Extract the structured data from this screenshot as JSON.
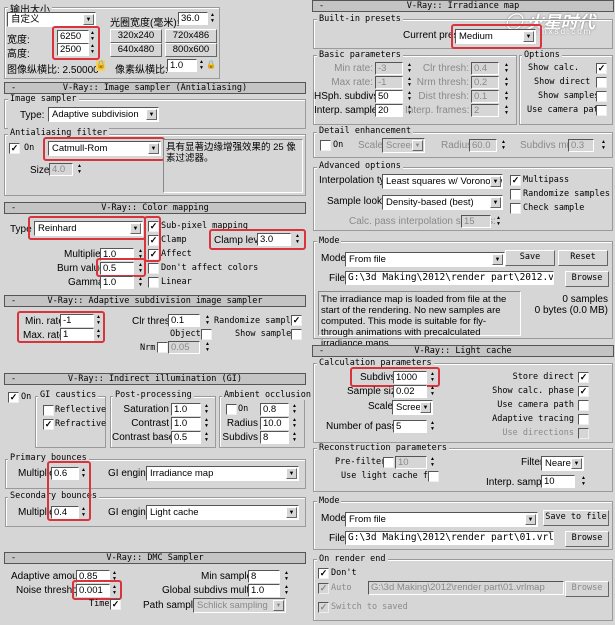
{
  "watermark": {
    "logo": "火星时代",
    "url": "www.hxsd.com"
  },
  "output_size": {
    "title": "输出大小",
    "preset": "自定义",
    "aperture_label": "光圈宽度(毫米):",
    "aperture": "36.0",
    "width_label": "宽度:",
    "width": "6250",
    "height_label": "高度:",
    "height": "2500",
    "presets": [
      "320x240",
      "720x486",
      "640x480",
      "800x600"
    ],
    "image_aspect": "图像纵横比: 2.50000",
    "pixel_aspect_label": "像素纵横比:",
    "pixel_aspect": "1.0"
  },
  "image_sampler": {
    "title": "V-Ray:: Image sampler (Antialiasing)",
    "group": "Image sampler",
    "type_label": "Type:",
    "type": "Adaptive subdivision",
    "aa_group": "Antialiasing filter",
    "on_label": "On",
    "filter": "Catmull-Rom",
    "filter_desc": "具有显著边缘增强效果的 25 像素过滤器。",
    "size_label": "Size:",
    "size": "4.0"
  },
  "color_mapping": {
    "title": "V-Ray:: Color mapping",
    "type_label": "Type",
    "type": "Reinhard",
    "sub_pixel": "Sub-pixel mapping",
    "clamp": "Clamp",
    "affect": "Affect",
    "clamp_level_label": "Clamp level:",
    "clamp_level": "3.0",
    "multiplier_label": "Multiplier:",
    "multiplier": "1.0",
    "burn_label": "Burn value:",
    "burn": "0.5",
    "dont_affect": "Don't affect colors",
    "gamma_label": "Gamma:",
    "gamma": "1.0",
    "linear": "Linear"
  },
  "adaptive": {
    "title": "V-Ray:: Adaptive subdivision image sampler",
    "min_label": "Min. rate:",
    "min": "-1",
    "max_label": "Max. rate:",
    "max": "1",
    "clr_label": "Clr thresh:",
    "clr": "0.1",
    "object": "Object",
    "nrm": "Nrm",
    "nrm_val": "0.05",
    "randomize": "Randomize samples",
    "show": "Show samples"
  },
  "gi": {
    "title": "V-Ray:: Indirect illumination (GI)",
    "on": "On",
    "caustics": "GI caustics",
    "reflective": "Reflective",
    "refractive": "Refractive",
    "post": "Post-processing",
    "saturation_label": "Saturation",
    "saturation": "1.0",
    "contrast_label": "Contrast",
    "contrast": "1.0",
    "contrast_base_label": "Contrast base",
    "contrast_base": "0.5",
    "ao": "Ambient occlusion",
    "ao_on": "On",
    "ao_amount": "0.8",
    "radius_label": "Radius",
    "radius": "10.0",
    "subdivs_label": "Subdivs",
    "subdivs": "8",
    "primary": "Primary bounces",
    "secondary": "Secondary bounces",
    "mult_label": "Multiplier",
    "primary_mult": "0.6",
    "secondary_mult": "0.4",
    "engine_label": "GI engine",
    "primary_engine": "Irradiance map",
    "secondary_engine": "Light cache"
  },
  "dmc": {
    "title": "V-Ray:: DMC Sampler",
    "adaptive_label": "Adaptive amount:",
    "adaptive": "0.85",
    "noise_label": "Noise threshold:",
    "noise": "0.001",
    "time": "Time",
    "min_label": "Min samples:",
    "min": "8",
    "global_label": "Global subdivs multiplier:",
    "global": "1.0",
    "path_label": "Path sampler:",
    "path": "Schlick sampling"
  },
  "irradiance": {
    "title": "V-Ray:: Irradiance map",
    "presets_group": "Built-in presets",
    "preset_label": "Current preset:",
    "preset": "Medium",
    "basic_group": "Basic parameters",
    "min_label": "Min rate:",
    "min": "-3",
    "max_label": "Max rate:",
    "max": "-1",
    "hsph_label": "HSph. subdivs:",
    "hsph": "50",
    "interp_label": "Interp. samples:",
    "interp": "20",
    "clr_label": "Clr thresh:",
    "clr": "0.4",
    "nrm_label": "Nrm thresh:",
    "nrm": "0.2",
    "dist_label": "Dist thresh:",
    "dist": "0.1",
    "frames_label": "Interp. frames:",
    "frames": "2",
    "options_group": "Options",
    "show_calc": "Show calc.",
    "show_direct": "Show direct",
    "show_samples": "Show samples",
    "camera_path": "Use camera path",
    "detail_group": "Detail enhancement",
    "detail_on": "On",
    "scale_label": "Scale:",
    "scale": "Screen",
    "radius_label": "Radius:",
    "radius": "60.0",
    "subdivs_mult_label": "Subdivs mult.",
    "subdivs_mult": "0.3",
    "advanced_group": "Advanced options",
    "interp_type_label": "Interpolation type:",
    "interp_type": "Least squares w/ Voronoi weig",
    "lookup_label": "Sample lookup:",
    "lookup": "Density-based (best)",
    "calc_pass_label": "Calc. pass interpolation samples:",
    "calc_pass": "15",
    "multipass": "Multipass",
    "randomize": "Randomize samples",
    "check_sample": "Check sample",
    "mode_group": "Mode",
    "mode_label": "Mode:",
    "mode": "From file",
    "save": "Save",
    "reset": "Reset",
    "file_label": "File:",
    "file": "G:\\3d Making\\2012\\render part\\2012.vrmap",
    "browse": "Browse",
    "mode_desc": "The irradiance map is loaded from file at the start of the rendering. No new samples are computed. This mode is suitable for fly-through animations with precalculated irradiance maps.",
    "samples": "0 samples",
    "bytes": "0 bytes (0.0 MB)"
  },
  "light_cache": {
    "title": "V-Ray:: Light cache",
    "calc_group": "Calculation parameters",
    "subdivs_label": "Subdivs:",
    "subdivs": "1000",
    "sample_size_label": "Sample size:",
    "sample_size": "0.02",
    "scale_label": "Scale:",
    "scale": "Screen",
    "passes_label": "Number of passes:",
    "passes": "5",
    "store_direct": "Store direct",
    "show_calc": "Show calc. phase",
    "camera_path": "Use camera path",
    "adaptive": "Adaptive tracing",
    "directions": "Use directions",
    "recon_group": "Reconstruction parameters",
    "prefilter": "Pre-filter:",
    "prefilter_val": "10",
    "use_lc": "Use light cache for",
    "filter_label": "Filter:",
    "filter": "Nearest",
    "interp_label": "Interp. samples:",
    "interp": "10",
    "mode_group": "Mode",
    "mode_label": "Mode:",
    "mode": "From file",
    "save_file": "Save to file",
    "file_label": "File:",
    "file": "G:\\3d Making\\2012\\render part\\01.vrlmap",
    "browse": "Browse",
    "end_group": "On render end",
    "dont_delete": "Don't",
    "auto_save": "Auto",
    "auto_file": "G:\\3d Making\\2012\\render part\\01.vrlmap",
    "browse2": "Browse",
    "switch": "Switch to saved"
  }
}
